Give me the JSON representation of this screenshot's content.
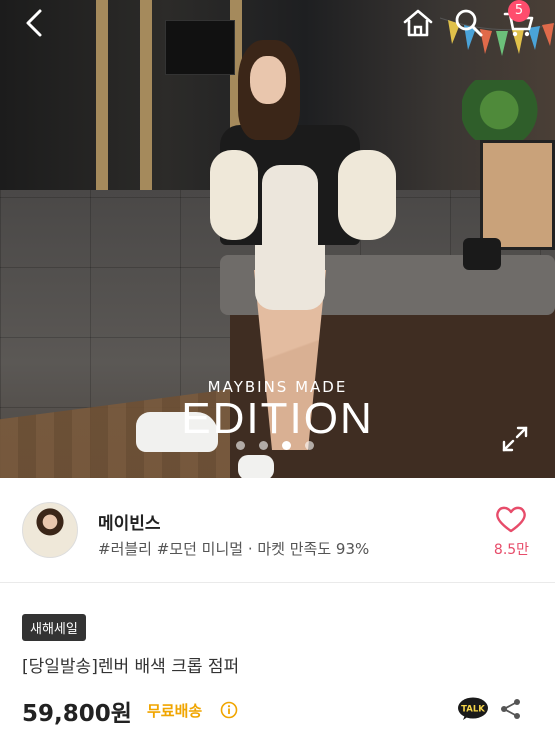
{
  "hero": {
    "watermark_top": "MAYBINS MADE",
    "watermark_main": "EDITION",
    "slide_count": 4,
    "active_slide": 3
  },
  "topbar": {
    "back_icon": "chevron-left-icon",
    "home_icon": "home-icon",
    "search_icon": "search-icon",
    "cart_icon": "cart-icon",
    "cart_count": "5"
  },
  "seller": {
    "name": "메이빈스",
    "tags": "#러블리 #모던 미니멀 · 마켓 만족도 93%",
    "like_count": "8.5만"
  },
  "product": {
    "badge": "새해세일",
    "title": "[당일발송]렌버 배색 크롭 점퍼",
    "price": "59,800원",
    "shipping": "무료배송",
    "talk_label": "TALK"
  },
  "colors": {
    "accent_pink": "#e74c6a",
    "badge_red": "#ff4d6d",
    "shipping_yellow": "#f0a500"
  }
}
